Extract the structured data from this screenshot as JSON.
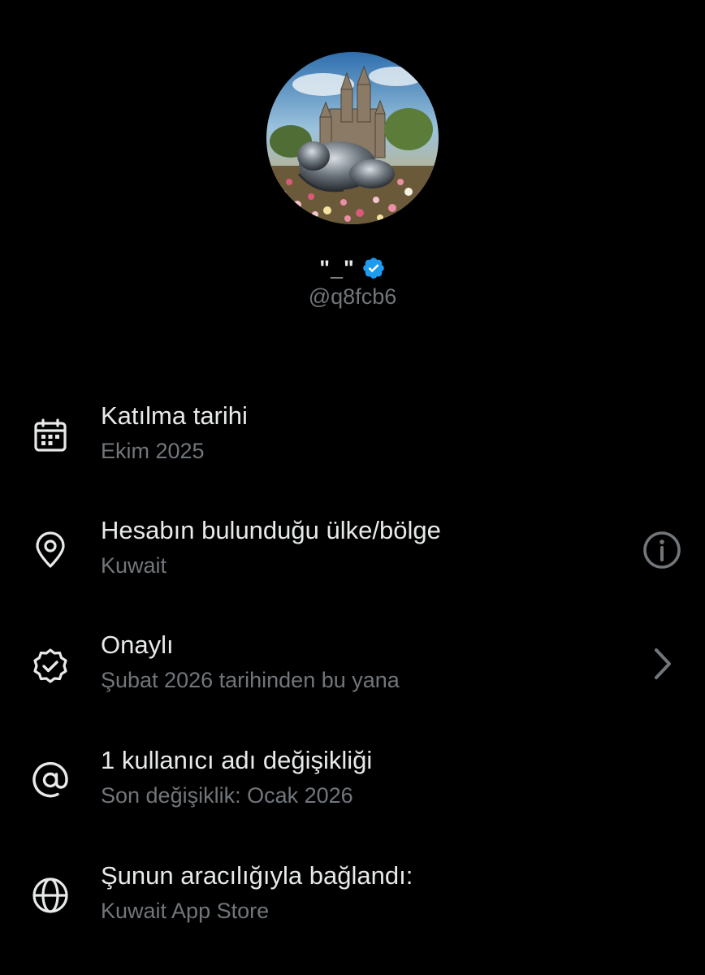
{
  "profile": {
    "display_name": "\"_\"",
    "handle": "@q8fcb6",
    "verified": true,
    "badge_color": "#1d9bf0"
  },
  "rows": [
    {
      "icon": "calendar-icon",
      "title": "Katılma tarihi",
      "subtitle": "Ekim 2025",
      "action": null
    },
    {
      "icon": "location-pin-icon",
      "title": "Hesabın bulunduğu ülke/bölge",
      "subtitle": "Kuwait",
      "action": "info-icon"
    },
    {
      "icon": "verified-badge-outline-icon",
      "title": "Onaylı",
      "subtitle": "Şubat 2026 tarihinden bu yana",
      "action": "chevron-right-icon"
    },
    {
      "icon": "at-sign-icon",
      "title": "1 kullanıcı adı değişikliği",
      "subtitle": "Son değişiklik: Ocak 2026",
      "action": null
    },
    {
      "icon": "globe-icon",
      "title": "Şunun aracılığıyla bağlandı:",
      "subtitle": "Kuwait App Store",
      "action": null
    }
  ],
  "colors": {
    "background": "#000000",
    "primary_text": "#e7e9ea",
    "secondary_text": "#71767b",
    "accent": "#1d9bf0"
  }
}
